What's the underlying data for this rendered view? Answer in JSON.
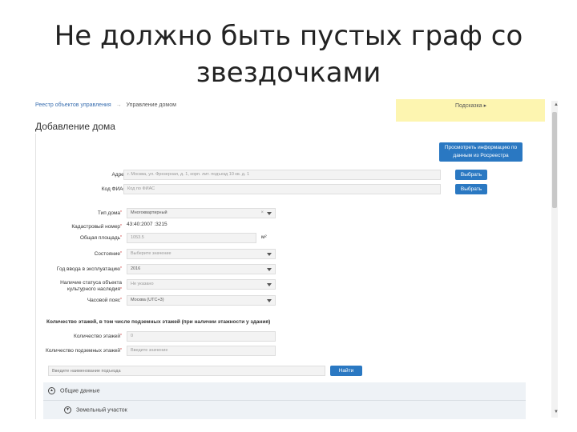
{
  "slide": {
    "title": "Не должно быть пустых граф со звездочками"
  },
  "breadcrumb": {
    "link1": "Реестр объектов управления",
    "separator": "→",
    "current": "Управление домом"
  },
  "notice": {
    "text": "Подсказка ▸"
  },
  "page": {
    "heading": "Добавление дома"
  },
  "buttons": {
    "rosreestr": "Просмотреть информацию по данным из Росреестра",
    "choose_address": "Выбрать",
    "choose_fias": "Выбрать",
    "find": "Найти"
  },
  "fields": {
    "address": {
      "label": "Адрес",
      "required": "*",
      "value": "г. Москва, ул. Фрезерная, д. 1, корп. лит. подъезд 10 кв. д. 1"
    },
    "fias": {
      "label": "Код ФИАС",
      "required": "*",
      "value": "Код по ФИАС"
    },
    "house_type": {
      "label": "Тип дома",
      "required": "*",
      "value": "Многоквартирный"
    },
    "cadastral": {
      "label": "Кадастровый номер",
      "required": "*",
      "value": "43:40:2007 :3215"
    },
    "area": {
      "label": "Общая площадь",
      "required": "*",
      "value": "1053.5",
      "unit": "м²"
    },
    "condition": {
      "label": "Состояние",
      "required": "*",
      "value": "Выберите значение"
    },
    "year": {
      "label": "Год ввода в эксплуатацию",
      "required": "*",
      "value": "2016"
    },
    "cultural": {
      "label": "Наличие статуса объекта культурного наследия",
      "required": "*",
      "value": "Не указано"
    },
    "timezone": {
      "label": "Часовой пояс",
      "required": "*",
      "value": "Москва (UTC+3)"
    },
    "floors_max": {
      "label": "Количество этажей",
      "required": "*",
      "value": "0"
    },
    "floors_min": {
      "label": "Количество подземных этажей",
      "required": "*",
      "value": "Введите значение"
    }
  },
  "floors_note": "Количество этажей, в том числе подземных этажей (при наличии этажности у здания)",
  "search": {
    "placeholder": "Введите наименование подъезда"
  },
  "sections": {
    "general": "Общие данные",
    "land": "Земельный участок"
  }
}
